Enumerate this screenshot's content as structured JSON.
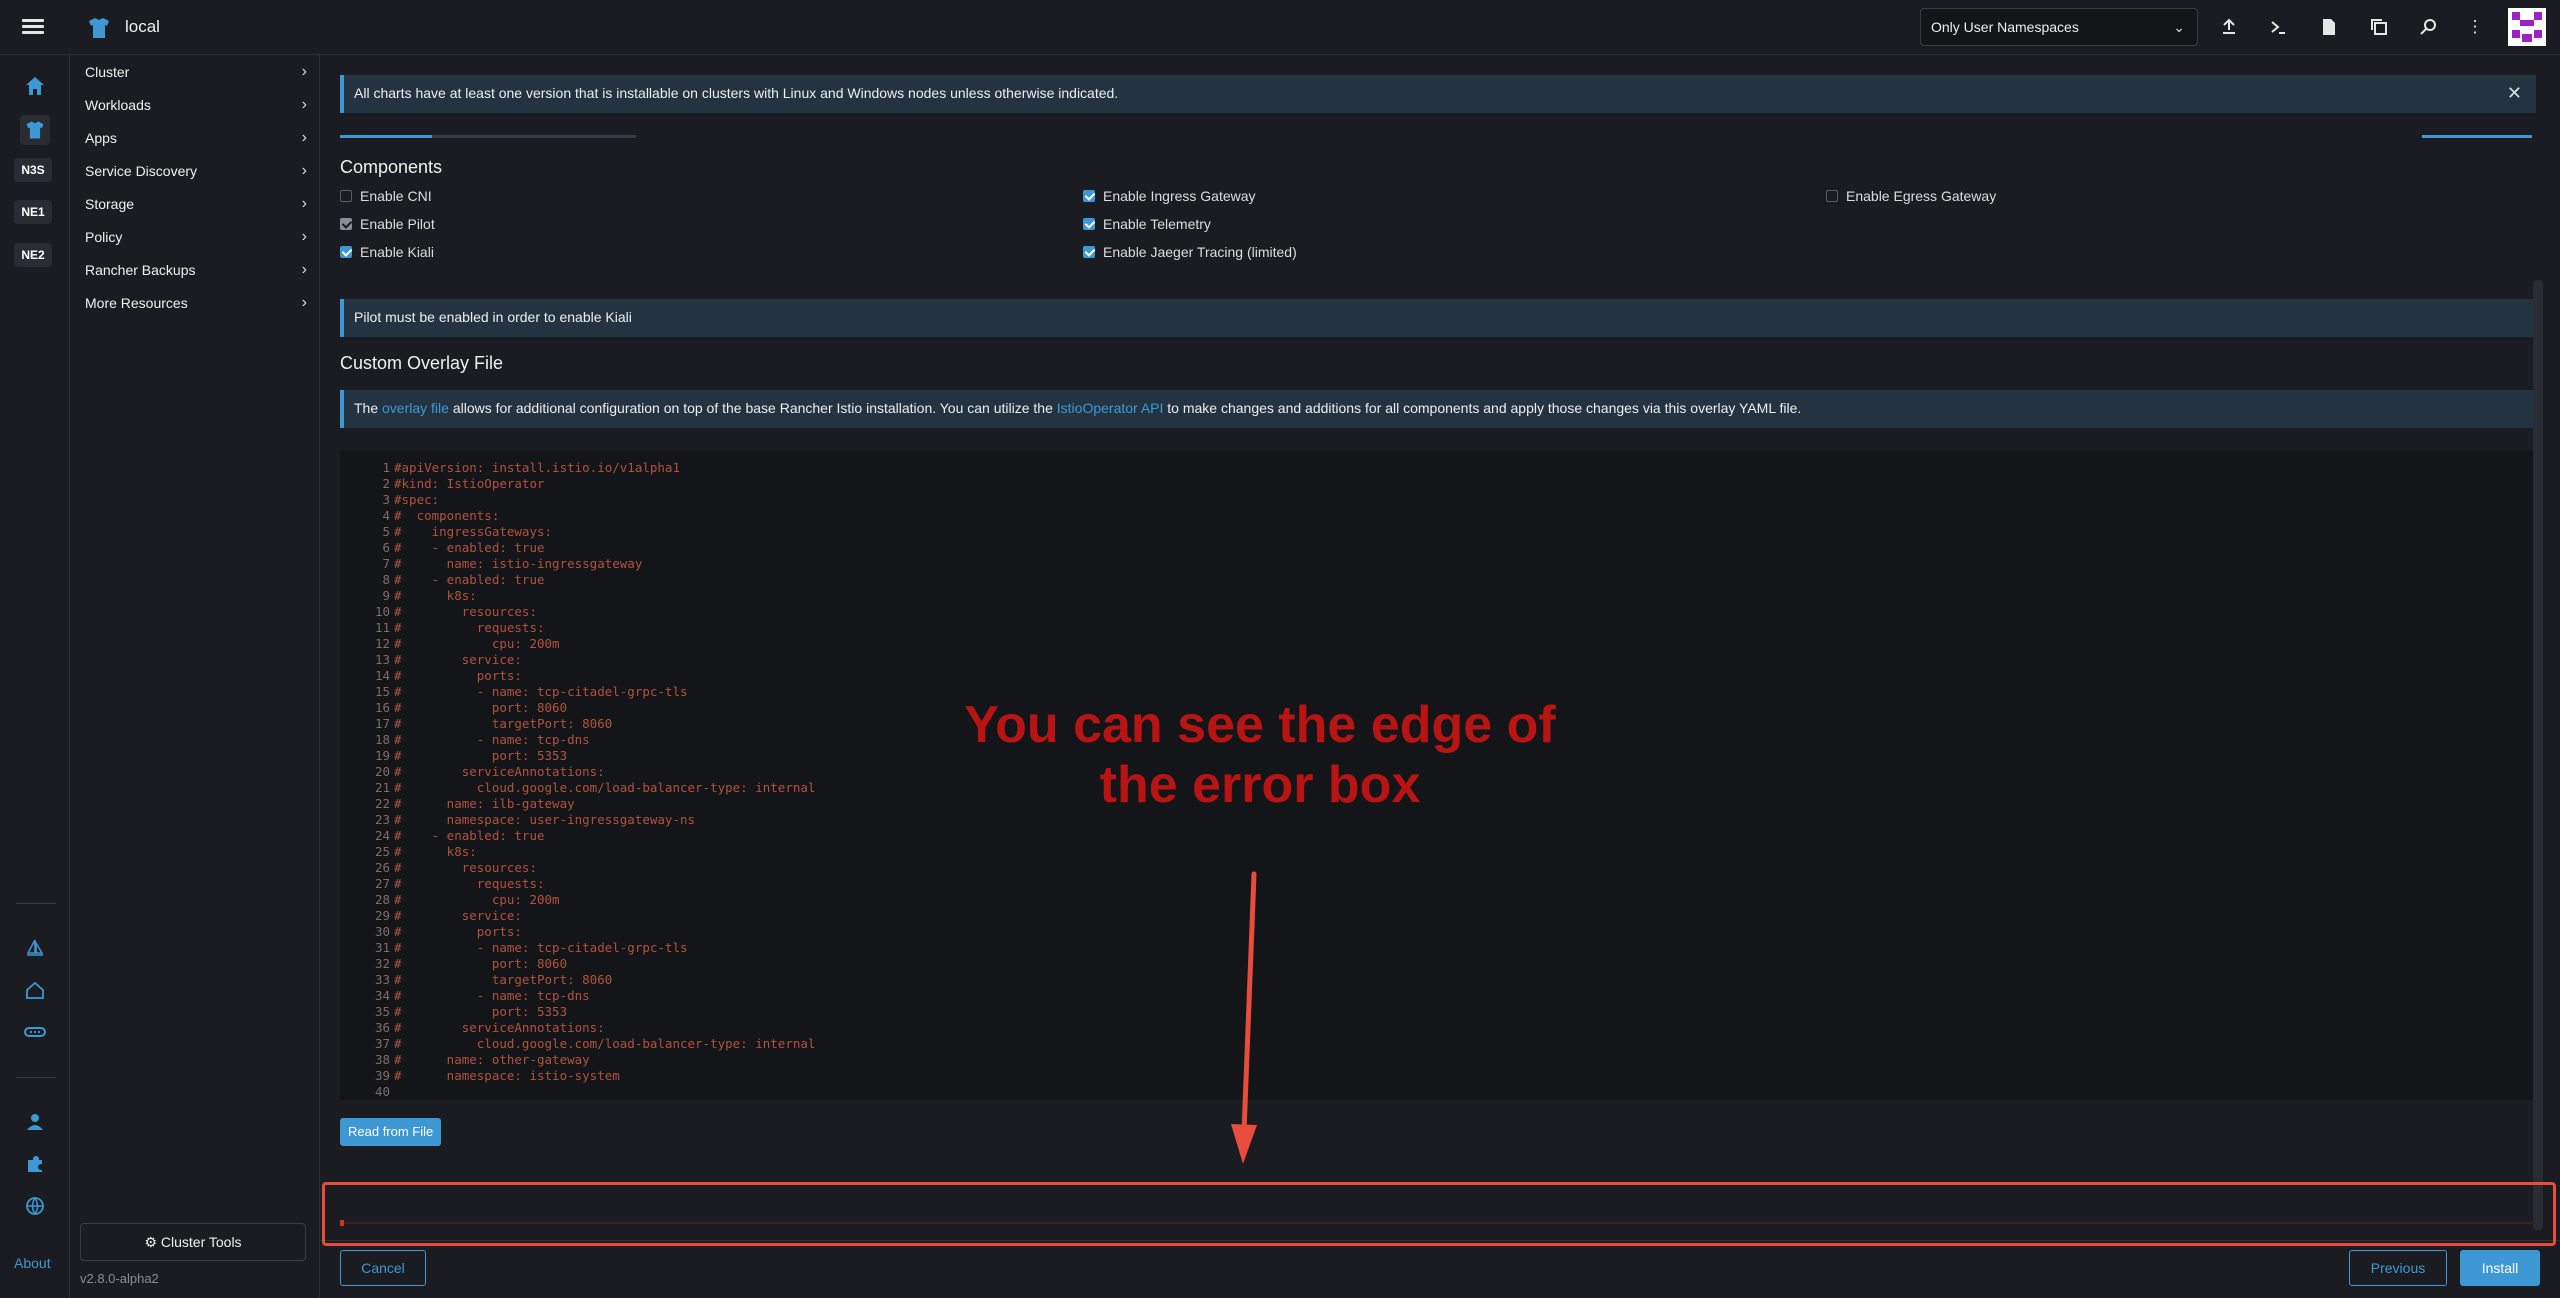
{
  "header": {
    "cluster_name": "local",
    "namespace_filter": "Only User Namespaces"
  },
  "rail": {
    "badges": [
      "N3S",
      "NE1",
      "NE2"
    ],
    "about": "About"
  },
  "nav": {
    "items": [
      {
        "label": "Cluster"
      },
      {
        "label": "Workloads"
      },
      {
        "label": "Apps"
      },
      {
        "label": "Service Discovery"
      },
      {
        "label": "Storage"
      },
      {
        "label": "Policy"
      },
      {
        "label": "Rancher Backups"
      },
      {
        "label": "More Resources"
      }
    ],
    "cluster_tools": "Cluster Tools",
    "version": "v2.8.0-alpha2"
  },
  "main": {
    "banner": "All charts have at least one version that is installable on clusters with Linux and Windows nodes unless otherwise indicated.",
    "components_title": "Components",
    "components": [
      {
        "label": "Enable CNI",
        "checked": false
      },
      {
        "label": "Enable Pilot",
        "checked": true
      },
      {
        "label": "Enable Kiali",
        "checked": true
      },
      {
        "label": "Enable Ingress Gateway",
        "checked": true
      },
      {
        "label": "Enable Telemetry",
        "checked": true
      },
      {
        "label": "Enable Jaeger Tracing (limited)",
        "checked": true
      },
      {
        "label": "Enable Egress Gateway",
        "checked": false
      }
    ],
    "kiali_notice": "Pilot must be enabled in order to enable Kiali",
    "overlay_title": "Custom Overlay File",
    "overlay_info": {
      "prefix": "The ",
      "link1": "overlay file",
      "middle": " allows for additional configuration on top of the base Rancher Istio installation. You can utilize the ",
      "link2": "IstioOperator API",
      "suffix": " to make changes and additions for all components and apply those changes via this overlay YAML file."
    },
    "code_lines": [
      "#apiVersion: install.istio.io/v1alpha1",
      "#kind: IstioOperator",
      "#spec:",
      "#  components:",
      "#    ingressGateways:",
      "#    - enabled: true",
      "#      name: istio-ingressgateway",
      "#    - enabled: true",
      "#      k8s:",
      "#        resources:",
      "#          requests:",
      "#            cpu: 200m",
      "#        service:",
      "#          ports:",
      "#          - name: tcp-citadel-grpc-tls",
      "#            port: 8060",
      "#            targetPort: 8060",
      "#          - name: tcp-dns",
      "#            port: 5353",
      "#        serviceAnnotations:",
      "#          cloud.google.com/load-balancer-type: internal",
      "#      name: ilb-gateway",
      "#      namespace: user-ingressgateway-ns",
      "#    - enabled: true",
      "#      k8s:",
      "#        resources:",
      "#          requests:",
      "#            cpu: 200m",
      "#        service:",
      "#          ports:",
      "#          - name: tcp-citadel-grpc-tls",
      "#            port: 8060",
      "#            targetPort: 8060",
      "#          - name: tcp-dns",
      "#            port: 5353",
      "#        serviceAnnotations:",
      "#          cloud.google.com/load-balancer-type: internal",
      "#      name: other-gateway",
      "#      namespace: istio-system",
      ""
    ],
    "read_from_file": "Read from File"
  },
  "footer": {
    "cancel": "Cancel",
    "previous": "Previous",
    "install": "Install"
  },
  "annotation": {
    "line1": "You can see the edge of",
    "line2": "the error box"
  },
  "colors": {
    "accent": "#3d98d3",
    "annotation_red": "#b81414",
    "box_red": "#e74c3c"
  }
}
